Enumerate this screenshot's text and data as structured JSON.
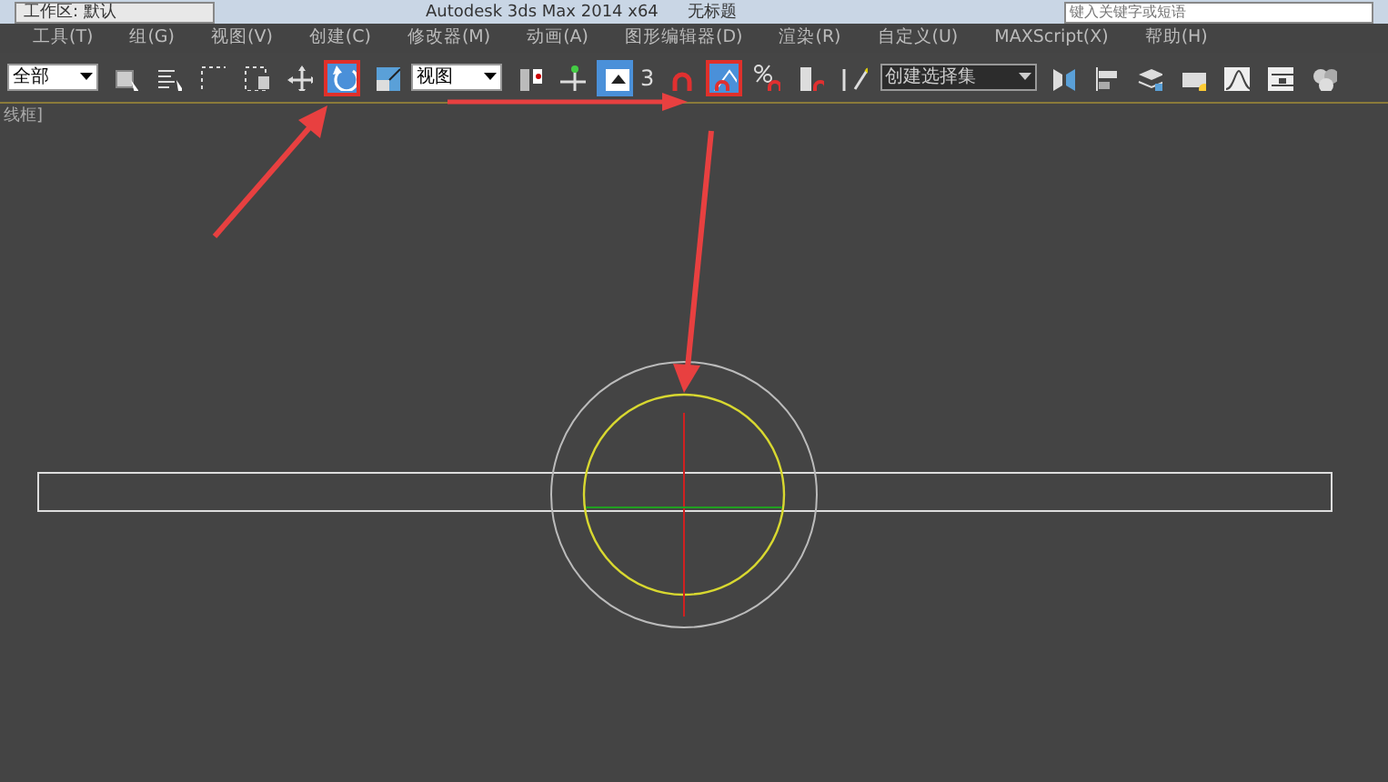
{
  "title_bar": {
    "workspace": "工作区: 默认",
    "title": "Autodesk 3ds Max  2014 x64",
    "document": "无标题",
    "search_placeholder": "键入关键字或短语"
  },
  "menu": [
    "工具(T)",
    "组(G)",
    "视图(V)",
    "创建(C)",
    "修改器(M)",
    "动画(A)",
    "图形编辑器(D)",
    "渲染(R)",
    "自定义(U)",
    "MAXScript(X)",
    "帮助(H)"
  ],
  "toolbar": [
    {
      "kind": "dropdown",
      "label": "全部"
    },
    {
      "kind": "select",
      "selected": false,
      "highlighted": false
    },
    {
      "kind": "list",
      "selected": false,
      "highlighted": false
    },
    {
      "kind": "region",
      "selected": false,
      "highlighted": false
    },
    {
      "kind": "crossing",
      "selected": false,
      "highlighted": false
    },
    {
      "kind": "move",
      "selected": false,
      "highlighted": false
    },
    {
      "kind": "rotate",
      "selected": true,
      "highlighted": true
    },
    {
      "kind": "scale",
      "selected": false,
      "highlighted": false
    },
    {
      "kind": "dropdown",
      "label": "视图"
    },
    {
      "kind": "pivot",
      "selected": false,
      "highlighted": false
    },
    {
      "kind": "manipulate",
      "selected": false,
      "highlighted": false
    },
    {
      "kind": "keyboard",
      "selected": true,
      "highlighted": false
    },
    {
      "kind": "snap",
      "label": "3",
      "selected": false,
      "highlighted": false
    },
    {
      "kind": "angle",
      "selected": true,
      "highlighted": true
    },
    {
      "kind": "percent",
      "selected": false,
      "highlighted": false
    },
    {
      "kind": "spinner",
      "selected": false,
      "highlighted": false
    },
    {
      "kind": "named",
      "selected": false,
      "highlighted": false
    },
    {
      "kind": "dropdown",
      "label": "创建选择集",
      "dark": true
    },
    {
      "kind": "mirror",
      "selected": false,
      "highlighted": false
    },
    {
      "kind": "align",
      "selected": false,
      "highlighted": false
    },
    {
      "kind": "layers",
      "selected": false,
      "highlighted": false
    },
    {
      "kind": "render",
      "selected": false,
      "highlighted": false
    },
    {
      "kind": "curve",
      "selected": false,
      "highlighted": false
    },
    {
      "kind": "schematic",
      "selected": false,
      "highlighted": false
    },
    {
      "kind": "material",
      "selected": false,
      "highlighted": false
    }
  ],
  "viewport": {
    "label": "线框]"
  }
}
